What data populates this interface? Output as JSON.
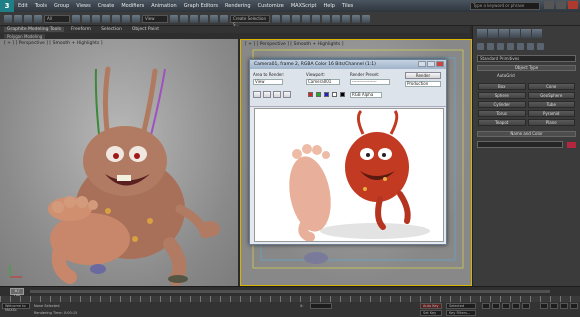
{
  "titlebar": {
    "logo": "3",
    "menus": [
      "Edit",
      "Tools",
      "Group",
      "Views",
      "Create",
      "Modifiers",
      "Animation",
      "Graph Editors",
      "Rendering",
      "Customize",
      "MAXScript",
      "Help",
      "Tiles"
    ],
    "search_placeholder": "Type a keyword or phrase"
  },
  "toolbar": {
    "selection_filter": "All",
    "view_dropdown": "View",
    "selection_set": "Create Selection S..."
  },
  "ribbon": {
    "tabs": [
      "Graphite Modeling Tools",
      "Freeform",
      "Selection",
      "Object Paint"
    ],
    "sub_tab": "Polygon Modeling"
  },
  "viewports": {
    "left_label": "[ + ] [ Perspective ] [ Smooth + Highlights ]",
    "right_label": "[ + ] [ Perspective ] [ Smooth + Highlights ]"
  },
  "render_window": {
    "title": "Camera01, frame 2, RGBA Color 16 Bits/Channel (1:1)",
    "area_label": "Area to Render:",
    "area_value": "View",
    "viewport_label": "Viewport:",
    "viewport_value": "Camera001",
    "preset_label": "Render Preset:",
    "preset_value": "-----------------",
    "render_button": "Render",
    "production_value": "Production",
    "channel_value": "RGB Alpha"
  },
  "command_panel": {
    "category": "Standard Primitives",
    "object_type_header": "Object Type",
    "autogrid": "AutoGrid",
    "buttons": [
      "Box",
      "Cone",
      "Sphere",
      "GeoSphere",
      "Cylinder",
      "Tube",
      "Torus",
      "Pyramid",
      "Teapot",
      "Plane"
    ],
    "name_color_header": "Name and Color",
    "colors": {
      "swatch": "#b4263e"
    }
  },
  "timeline": {
    "slider_label": "0 / 100"
  },
  "statusbar": {
    "selection_text": "None Selected",
    "prompt_text": "Rendering Time: 0:00:15",
    "maxscript": "Welcome to MAXSc",
    "x_label": "X:",
    "autokey": "Auto Key",
    "selected": "Selected",
    "setkey": "Set Key",
    "key_filters": "Key Filters..."
  }
}
